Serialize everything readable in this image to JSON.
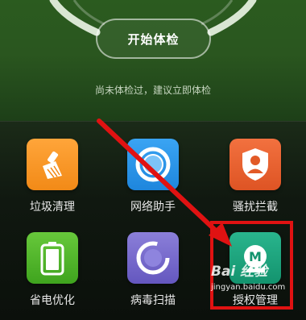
{
  "header": {
    "check_button_label": "开始体检",
    "hint_text": "尚未体检过，建议立即体检"
  },
  "tools": [
    {
      "label": "垃圾清理",
      "icon": "broom-icon",
      "color": "#f7961f"
    },
    {
      "label": "网络助手",
      "icon": "network-ring-icon",
      "color": "#2a94e8"
    },
    {
      "label": "骚扰拦截",
      "icon": "shield-person-icon",
      "color": "#e8602d"
    },
    {
      "label": "省电优化",
      "icon": "battery-icon",
      "color": "#4cb52a"
    },
    {
      "label": "病毒扫描",
      "icon": "scan-ring-icon",
      "color": "#7468cc"
    },
    {
      "label": "授权管理",
      "icon": "permission-m-icon",
      "color": "#1aa47c"
    }
  ],
  "annotation": {
    "highlight_color": "#e01212"
  },
  "watermark": {
    "text": "Bai 经验",
    "url": "jingyan.baidu.com"
  }
}
